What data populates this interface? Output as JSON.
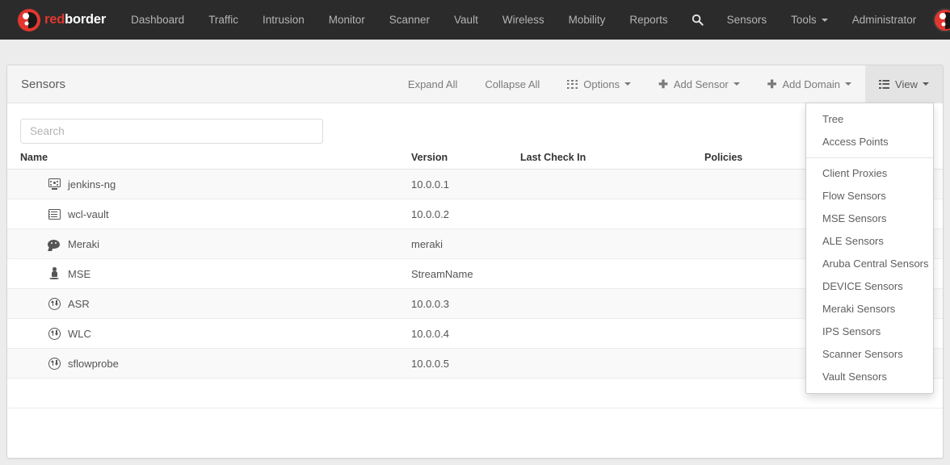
{
  "navbar": {
    "brand": {
      "first": "red",
      "second": "border"
    },
    "items": [
      {
        "label": "Dashboard"
      },
      {
        "label": "Traffic"
      },
      {
        "label": "Intrusion"
      },
      {
        "label": "Monitor"
      },
      {
        "label": "Scanner"
      },
      {
        "label": "Vault"
      },
      {
        "label": "Wireless"
      },
      {
        "label": "Mobility"
      },
      {
        "label": "Reports"
      }
    ],
    "search_icon": "search-icon",
    "right_items": [
      {
        "label": "Sensors",
        "caret": false
      },
      {
        "label": "Tools",
        "caret": true
      },
      {
        "label": "Administrator",
        "caret": false
      }
    ],
    "avatar": "user-avatar"
  },
  "panel": {
    "title": "Sensors",
    "tools": [
      {
        "label": "Expand All",
        "icon": null,
        "active": false
      },
      {
        "label": "Collapse All",
        "icon": null,
        "active": false
      },
      {
        "label": "Options",
        "icon": "grid-icon",
        "caret": true,
        "active": false
      },
      {
        "label": "Add Sensor",
        "icon": "plus-icon",
        "caret": true,
        "active": false
      },
      {
        "label": "Add Domain",
        "icon": "plus-icon",
        "caret": true,
        "active": false
      },
      {
        "label": "View",
        "icon": "list-icon",
        "caret": true,
        "active": true
      }
    ]
  },
  "search": {
    "placeholder": "Search",
    "value": ""
  },
  "table": {
    "headers": [
      "Name",
      "Version",
      "Last Check In",
      "Policies"
    ],
    "rows": [
      {
        "icon": "monitor-icon",
        "name": "jenkins-ng",
        "version": "10.0.0.1",
        "last_check_in": "",
        "policies": ""
      },
      {
        "icon": "list-icon",
        "name": "wcl-vault",
        "version": "10.0.0.2",
        "last_check_in": "",
        "policies": ""
      },
      {
        "icon": "cloud-icon",
        "name": "Meraki",
        "version": "meraki",
        "last_check_in": "",
        "policies": ""
      },
      {
        "icon": "person-icon",
        "name": "MSE",
        "version": "StreamName",
        "last_check_in": "",
        "policies": ""
      },
      {
        "icon": "exchange-icon",
        "name": "ASR",
        "version": "10.0.0.3",
        "last_check_in": "",
        "policies": ""
      },
      {
        "icon": "exchange-icon",
        "name": "WLC",
        "version": "10.0.0.4",
        "last_check_in": "",
        "policies": ""
      },
      {
        "icon": "exchange-icon",
        "name": "sflowprobe",
        "version": "10.0.0.5",
        "last_check_in": "",
        "policies": ""
      }
    ]
  },
  "view_dropdown": {
    "items": [
      {
        "label": "Tree",
        "separator_after": false
      },
      {
        "label": "Access Points",
        "separator_after": true
      },
      {
        "label": "Client Proxies",
        "separator_after": false
      },
      {
        "label": "Flow Sensors",
        "separator_after": false
      },
      {
        "label": "MSE Sensors",
        "separator_after": false
      },
      {
        "label": "ALE Sensors",
        "separator_after": false
      },
      {
        "label": "Aruba Central Sensors",
        "separator_after": false
      },
      {
        "label": "DEVICE Sensors",
        "separator_after": false
      },
      {
        "label": "Meraki Sensors",
        "separator_after": false
      },
      {
        "label": "IPS Sensors",
        "separator_after": false
      },
      {
        "label": "Scanner Sensors",
        "separator_after": false
      },
      {
        "label": "Vault Sensors",
        "separator_after": false
      }
    ]
  },
  "colors": {
    "brand_red": "#e2372f",
    "navbar_bg": "#2b2b2b",
    "page_bg": "#ececec",
    "panel_head_bg": "#f5f5f5",
    "active_tool_bg": "#e4e4e4"
  }
}
